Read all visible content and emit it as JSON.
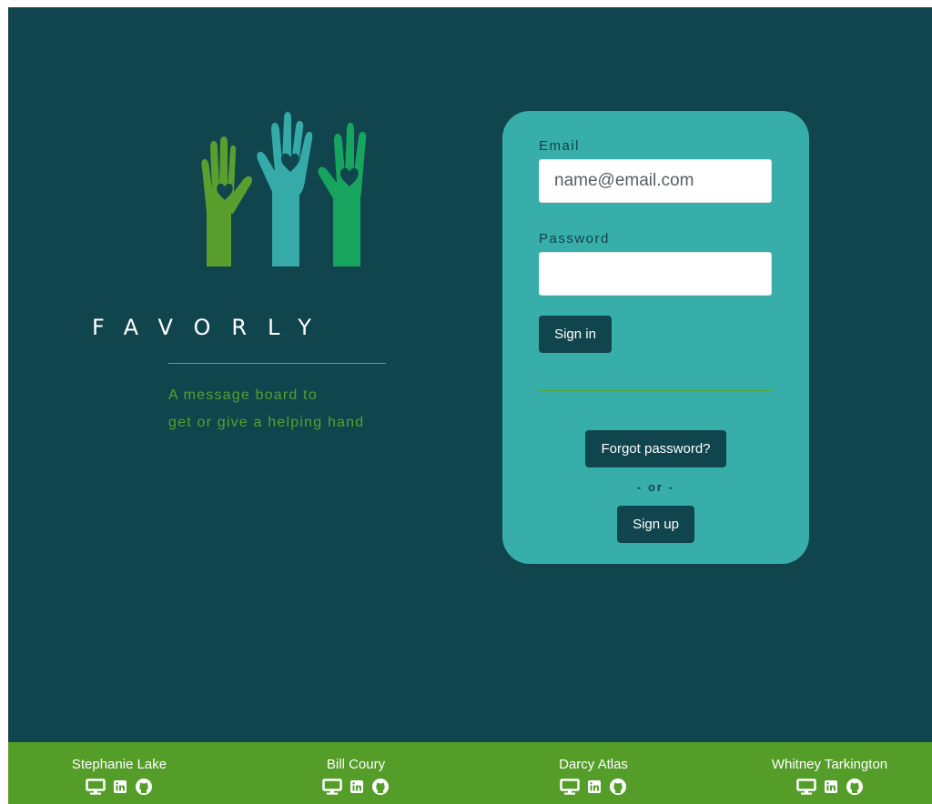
{
  "brand": {
    "name": "FAVORLY",
    "tagline_line1": "A message board to",
    "tagline_line2": "get or give a helping hand"
  },
  "login": {
    "email_label": "Email",
    "email_placeholder": "name@email.com",
    "password_label": "Password",
    "password_placeholder": "",
    "sign_in_label": "Sign in",
    "forgot_label": "Forgot password?",
    "or_label": "- or -",
    "sign_up_label": "Sign up"
  },
  "footer": {
    "members": [
      {
        "name": "Stephanie Lake",
        "icons": [
          "monitor-icon",
          "linkedin-icon",
          "github-icon"
        ]
      },
      {
        "name": "Bill Coury",
        "icons": [
          "monitor-icon",
          "linkedin-icon",
          "github-icon"
        ]
      },
      {
        "name": "Darcy Atlas",
        "icons": [
          "monitor-icon",
          "linkedin-icon",
          "github-icon"
        ]
      },
      {
        "name": "Whitney Tarkington",
        "icons": [
          "monitor-icon",
          "linkedin-icon",
          "github-icon"
        ]
      }
    ]
  },
  "colors": {
    "background": "#10454d",
    "card": "#38aeab",
    "accent_green": "#56a02a",
    "footer": "#559d29",
    "button": "#10454d",
    "hand_left": "#5a9e2e",
    "hand_middle": "#35aaa8",
    "hand_right": "#17a45f"
  }
}
